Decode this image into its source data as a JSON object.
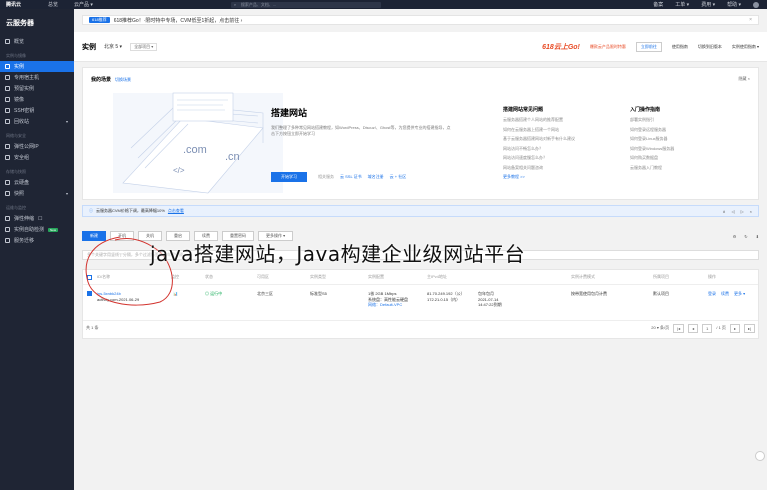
{
  "topbar": {
    "logo": "腾讯云",
    "nav": [
      "总览",
      "云产品 ▾"
    ],
    "search_placeholder": "搜索产品、文档、...",
    "right": [
      "备案",
      "工单 ▾",
      "费用 ▾",
      "帮助 ▾"
    ]
  },
  "sidebar": {
    "title": "云服务器",
    "items_top": [
      {
        "label": "概览"
      }
    ],
    "group1": "实例与镜像",
    "items1": [
      {
        "label": "实例",
        "active": true
      },
      {
        "label": "专用宿主机"
      },
      {
        "label": "预留实例"
      },
      {
        "label": "镜像"
      },
      {
        "label": "SSH密钥"
      },
      {
        "label": "回收站",
        "chev": true
      }
    ],
    "group2": "网络与安全",
    "items2": [
      {
        "label": "弹性公网IP"
      },
      {
        "label": "安全组"
      }
    ],
    "group3": "存储与快照",
    "items3": [
      {
        "label": "云硬盘"
      },
      {
        "label": "快照",
        "chev": true
      }
    ],
    "group4": "运维与监控",
    "items4": [
      {
        "label": "弹性伸缩",
        "extra": "☐"
      },
      {
        "label": "实例自助检测",
        "new": "New"
      },
      {
        "label": "服务迁移"
      }
    ]
  },
  "notice": {
    "tag": "618推荐",
    "text": "618推荐Go！·限时特中专场，CVM低至1折起，点击前往 ›"
  },
  "header": {
    "title": "实例",
    "region": "北京 5 ▾",
    "project": "全部项目 ▾",
    "promo": "618云上Go!",
    "promo_sub": "爆款云产品限时特惠",
    "buttons": [
      "立即前往",
      "使用指南",
      "切换到旧版本",
      "实例使用指南 ▾"
    ]
  },
  "card": {
    "title": "我的场景",
    "title_link": "切换场景",
    "right": "隐藏 ×",
    "heading": "搭建网站",
    "desc": "我们整理了多种常见网站搭建教程，如WordPress、Discuz!、Ghost等，为您提供专业的搭建指导，点击下方按钮立即开始学习",
    "start": "开始学习",
    "links_label": "相关服务",
    "links": [
      "云 SSL 证书",
      "域名注册",
      "云 + 社区"
    ],
    "col1": {
      "title": "搭建网站常见问题",
      "items": [
        "云服务器搭建个人网站的推荐配置",
        "如何在云服务器上搭建一个网站",
        "基于云服务器搭建网站对新手有什么建议",
        "网站访问不畅怎么办？",
        "网站访问速度慢怎么办？",
        "网站备案相关问题咨询"
      ],
      "more": "更多教程 >>"
    },
    "col2": {
      "title": "入门操作指南",
      "items": [
        "部署实例指引",
        "如何登录远程服务器",
        "如何登录Linux服务器",
        "如何登录Windows服务器",
        "如何购买数据盘",
        "云服务器入门教程"
      ]
    },
    "illus": {
      "text1": ".com",
      "text2": ".cn",
      "code": "</>"
    }
  },
  "alert": {
    "text": "云服务器CVM价格下调，最高降幅10%",
    "link": "点击查看",
    "controls": [
      "∧",
      "◁",
      "▷",
      "×"
    ]
  },
  "toolbar": {
    "buttons": [
      "新建",
      "开机",
      "关机",
      "重启",
      "续费",
      "重置密码",
      "更多操作 ▾"
    ],
    "right": [
      "⚙",
      "↻",
      "⬇"
    ]
  },
  "search": {
    "placeholder": "多个关键字用竖线\"|\"分隔，多个过滤标签用回车键分隔"
  },
  "table": {
    "headers": [
      "ID/名称",
      "监控",
      "状态",
      "可用区",
      "实例类型",
      "实例配置",
      "主IPv4地址",
      "实例计费模式",
      "所属项目",
      "操作"
    ],
    "rows": [
      {
        "id": "ins-5xnbk24b",
        "name": "activity.com-2021.06-29",
        "status": "运行中",
        "zone": "北京三区",
        "type": "标准型S5",
        "config": [
          "1核 2GB 1Mbps",
          "系统盘：高性能云硬盘",
          "网络：Default-VPC"
        ],
        "ip": [
          "81.70.249.192（公）",
          "172.21.0.15（内）"
        ],
        "billing": [
          "包年包月",
          "2021-07-14",
          "14:47:22到期"
        ],
        "charge": "按带宽使用包月计费",
        "project": "默认项目",
        "ops": [
          "登录",
          "续费",
          "更多 ▾"
        ]
      }
    ]
  },
  "pager": {
    "selected": "共 1 条",
    "per": "20 ▾ 条/页",
    "page": "1",
    "total": "/ 1 页"
  },
  "overlay_caption": "java搭建网站，Java构建企业级网站平台"
}
